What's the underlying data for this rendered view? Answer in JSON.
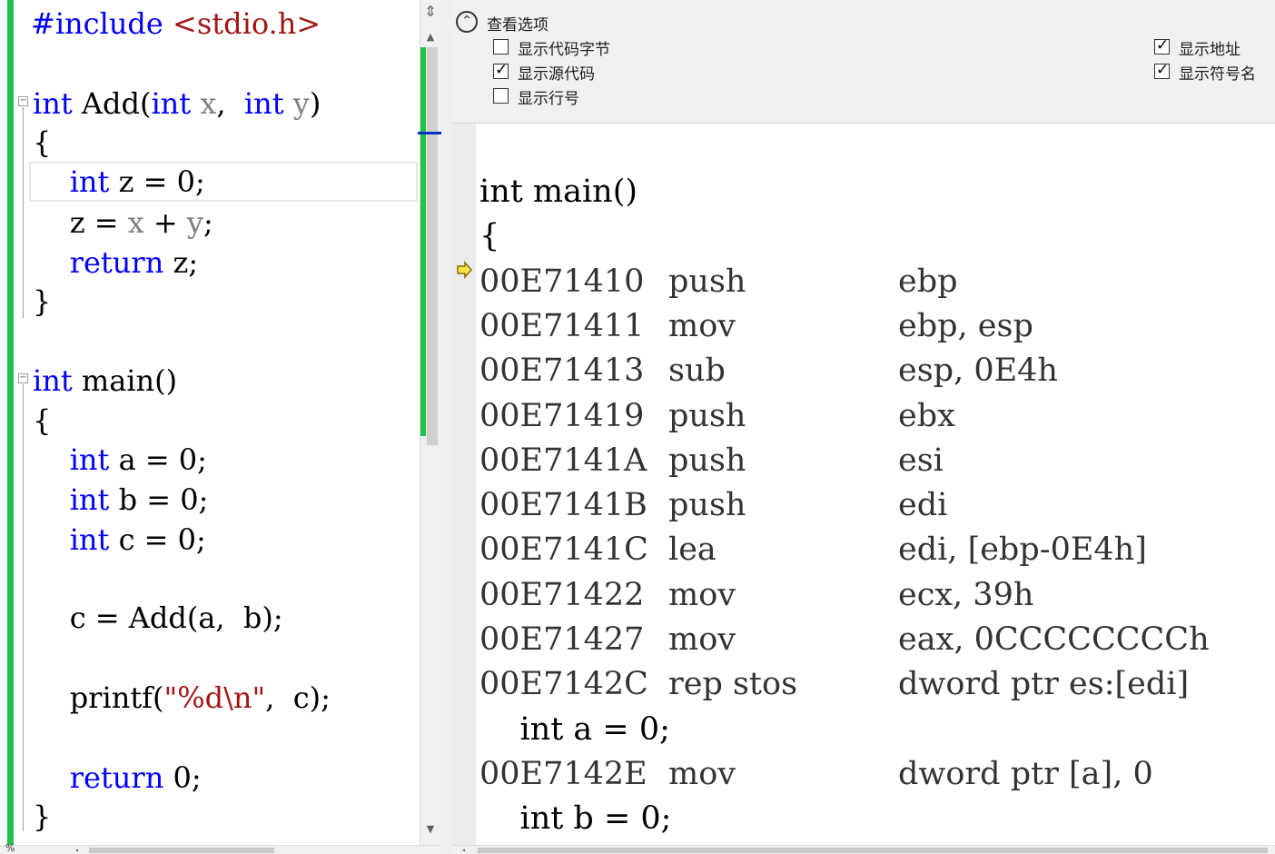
{
  "source_editor": {
    "lines": [
      {
        "parts": [
          {
            "t": "#include ",
            "c": "pp"
          },
          {
            "t": "<stdio.h>",
            "c": "inc"
          }
        ]
      },
      {
        "parts": []
      },
      {
        "parts": [
          {
            "t": "int",
            "c": "kw"
          },
          {
            "t": " Add(",
            "c": ""
          },
          {
            "t": "int",
            "c": "kw"
          },
          {
            "t": " ",
            "c": ""
          },
          {
            "t": "x",
            "c": "prm"
          },
          {
            "t": ",  ",
            "c": ""
          },
          {
            "t": "int",
            "c": "kw"
          },
          {
            "t": " ",
            "c": ""
          },
          {
            "t": "y",
            "c": "prm"
          },
          {
            "t": ")",
            "c": ""
          }
        ]
      },
      {
        "parts": [
          {
            "t": "{",
            "c": ""
          }
        ]
      },
      {
        "parts": [
          {
            "t": "    ",
            "c": ""
          },
          {
            "t": "int",
            "c": "kw"
          },
          {
            "t": " z = 0;",
            "c": ""
          }
        ]
      },
      {
        "parts": [
          {
            "t": "    z = ",
            "c": ""
          },
          {
            "t": "x",
            "c": "prm"
          },
          {
            "t": " + ",
            "c": ""
          },
          {
            "t": "y",
            "c": "prm"
          },
          {
            "t": ";",
            "c": ""
          }
        ]
      },
      {
        "parts": [
          {
            "t": "    ",
            "c": ""
          },
          {
            "t": "return",
            "c": "kw"
          },
          {
            "t": " z;",
            "c": ""
          }
        ]
      },
      {
        "parts": [
          {
            "t": "}",
            "c": ""
          }
        ]
      },
      {
        "parts": []
      },
      {
        "parts": [
          {
            "t": "int",
            "c": "kw"
          },
          {
            "t": " main()",
            "c": ""
          }
        ]
      },
      {
        "parts": [
          {
            "t": "{",
            "c": ""
          }
        ]
      },
      {
        "parts": [
          {
            "t": "    ",
            "c": ""
          },
          {
            "t": "int",
            "c": "kw"
          },
          {
            "t": " a = 0;",
            "c": ""
          }
        ]
      },
      {
        "parts": [
          {
            "t": "    ",
            "c": ""
          },
          {
            "t": "int",
            "c": "kw"
          },
          {
            "t": " b = 0;",
            "c": ""
          }
        ]
      },
      {
        "parts": [
          {
            "t": "    ",
            "c": ""
          },
          {
            "t": "int",
            "c": "kw"
          },
          {
            "t": " c = 0;",
            "c": ""
          }
        ]
      },
      {
        "parts": []
      },
      {
        "parts": [
          {
            "t": "    c = Add(a,  b);",
            "c": ""
          }
        ]
      },
      {
        "parts": []
      },
      {
        "parts": [
          {
            "t": "    printf(",
            "c": ""
          },
          {
            "t": "\"%d\\n\"",
            "c": "str"
          },
          {
            "t": ",  c);",
            "c": ""
          }
        ]
      },
      {
        "parts": []
      },
      {
        "parts": [
          {
            "t": "    ",
            "c": ""
          },
          {
            "t": "return",
            "c": "kw"
          },
          {
            "t": " 0;",
            "c": ""
          }
        ]
      },
      {
        "parts": [
          {
            "t": "}",
            "c": ""
          }
        ]
      }
    ]
  },
  "options": {
    "header": "查看选项",
    "items": [
      {
        "label": "显示代码字节",
        "checked": false
      },
      {
        "label": "显示源代码",
        "checked": true
      },
      {
        "label": "显示行号",
        "checked": false
      },
      {
        "label": "显示地址",
        "checked": true
      },
      {
        "label": "显示符号名",
        "checked": true
      }
    ]
  },
  "disassembly": {
    "lines": [
      {
        "type": "src",
        "text": "int main()"
      },
      {
        "type": "src",
        "text": "{"
      },
      {
        "type": "asm",
        "addr": "00E71410",
        "op": "push",
        "arg": "ebp",
        "current": true
      },
      {
        "type": "asm",
        "addr": "00E71411",
        "op": "mov",
        "arg": "ebp, esp"
      },
      {
        "type": "asm",
        "addr": "00E71413",
        "op": "sub",
        "arg": "esp, 0E4h"
      },
      {
        "type": "asm",
        "addr": "00E71419",
        "op": "push",
        "arg": "ebx"
      },
      {
        "type": "asm",
        "addr": "00E7141A",
        "op": "push",
        "arg": "esi"
      },
      {
        "type": "asm",
        "addr": "00E7141B",
        "op": "push",
        "arg": "edi"
      },
      {
        "type": "asm",
        "addr": "00E7141C",
        "op": "lea",
        "arg": "edi, [ebp-0E4h]"
      },
      {
        "type": "asm",
        "addr": "00E71422",
        "op": "mov",
        "arg": "ecx, 39h"
      },
      {
        "type": "asm",
        "addr": "00E71427",
        "op": "mov",
        "arg": "eax, 0CCCCCCCCh"
      },
      {
        "type": "asm",
        "addr": "00E7142C",
        "op": "rep stos",
        "arg": "dword ptr es:[edi]"
      },
      {
        "type": "src",
        "text": "    int a = 0;"
      },
      {
        "type": "asm",
        "addr": "00E7142E",
        "op": "mov",
        "arg": "dword ptr [a], 0"
      },
      {
        "type": "src",
        "text": "    int b = 0;"
      }
    ]
  },
  "status": {
    "zoom_label": "%"
  }
}
